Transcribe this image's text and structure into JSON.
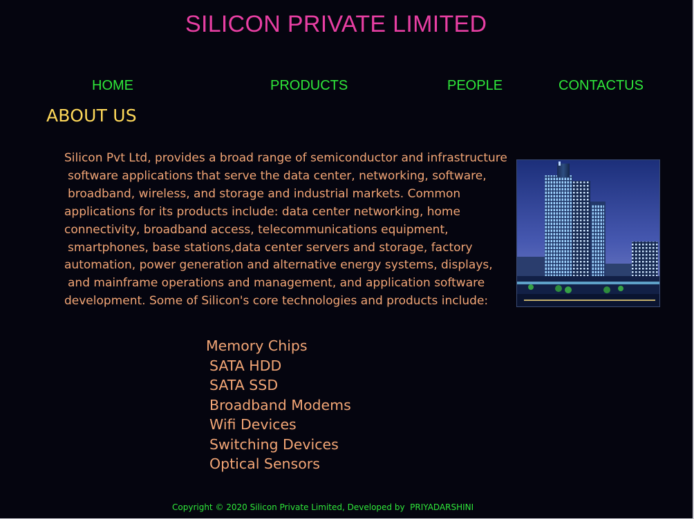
{
  "colors": {
    "background": "#05050f",
    "title": "#e83fa3",
    "nav": "#2fe83a",
    "heading": "#ffd95a",
    "body_text": "#f3a676",
    "footer": "#2fe83a"
  },
  "header": {
    "title": "SILICON PRIVATE LIMITED"
  },
  "nav": {
    "home": "HOME",
    "products": "PRODUCTS",
    "people": "PEOPLE",
    "contact": "CONTACTUS"
  },
  "about": {
    "heading": "ABOUT US",
    "lines": [
      "Silicon Pvt Ltd, provides a broad range of semiconductor and infrastructure",
      "software applications that serve the data center, networking, software,",
      "broadband, wireless, and storage and industrial markets. Common",
      "applications for its products include: data center networking, home",
      "connectivity, broadband access, telecommunications equipment,",
      "smartphones, base stations,data center servers and storage, factory",
      "automation, power generation and alternative energy systems, displays,",
      "and mainframe operations and management, and application software",
      "development. Some of Silicon's core technologies and products include:"
    ]
  },
  "image": {
    "icon": "office-building-image"
  },
  "products": [
    "Memory Chips",
    "SATA HDD",
    "SATA SSD",
    "Broadband Modems",
    "Wifi Devices",
    "Switching Devices",
    "Optical Sensors"
  ],
  "footer": {
    "text": "Copyright © 2020 Silicon Private Limited, Developed by  PRIYADARSHINI"
  }
}
